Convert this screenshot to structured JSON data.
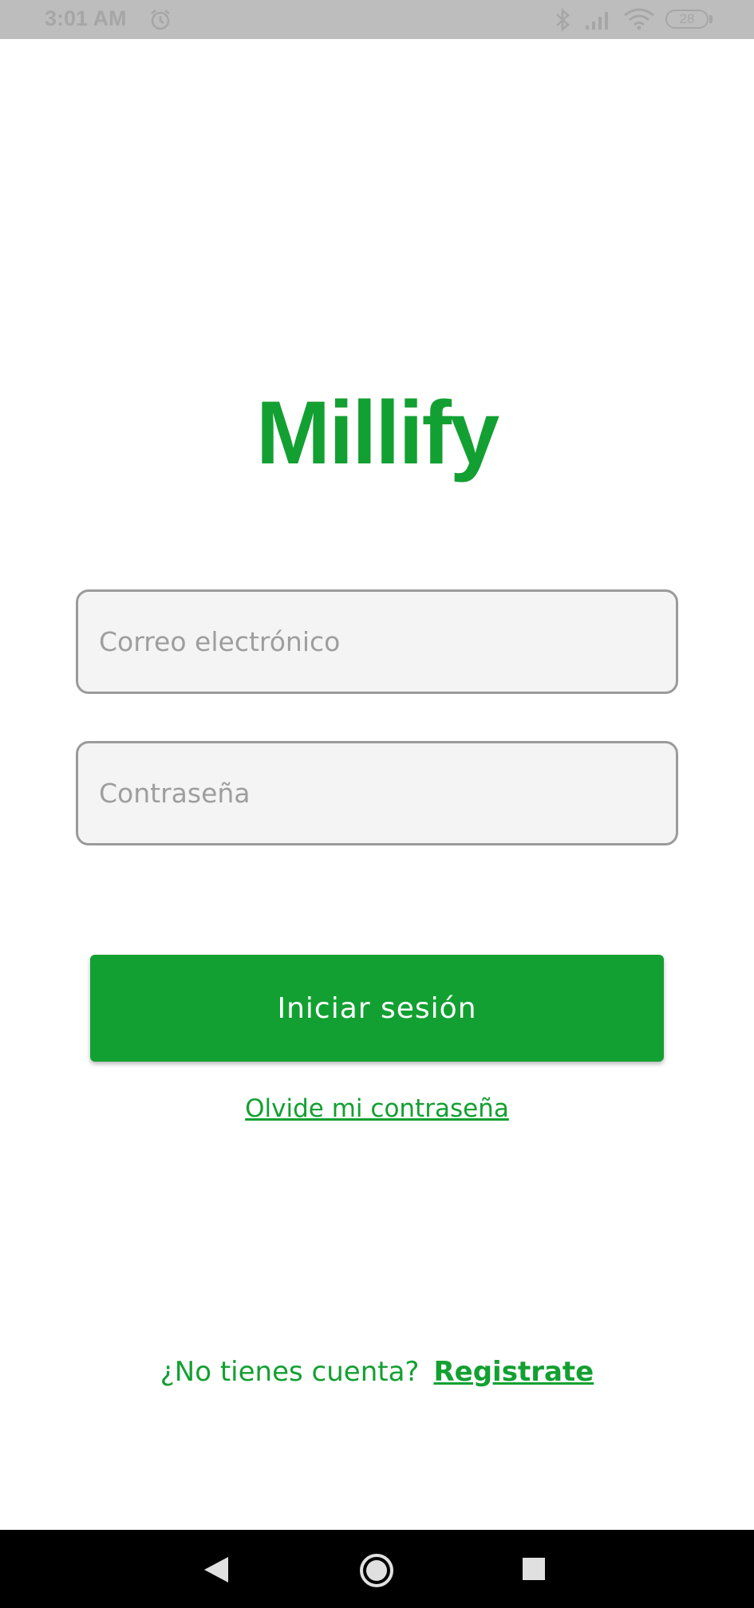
{
  "status_bar": {
    "time": "3:01 AM",
    "battery": "28",
    "icons": [
      "alarm-icon",
      "bluetooth-icon",
      "signal-icon",
      "wifi-icon",
      "battery-icon"
    ]
  },
  "app": {
    "logo": "Millify",
    "brand_color": "#13a032"
  },
  "form": {
    "email_placeholder": "Correo electrónico",
    "email_value": "",
    "password_placeholder": "Contraseña",
    "password_value": "",
    "login_label": "Iniciar sesión",
    "forgot_label": "Olvide mi contraseña"
  },
  "signup": {
    "prompt": "¿No tienes cuenta?",
    "link_label": "Registrate"
  },
  "nav_bar": {
    "icons": [
      "back-icon",
      "home-icon",
      "recent-apps-icon"
    ]
  }
}
